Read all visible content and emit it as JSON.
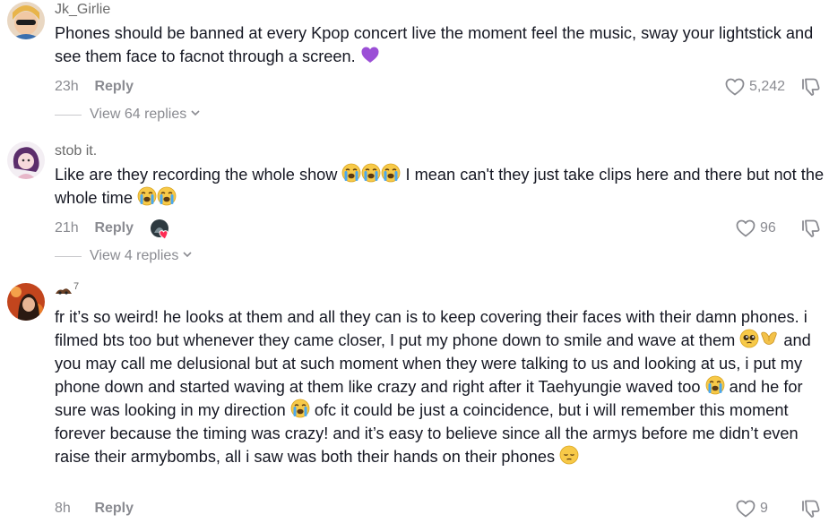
{
  "comments": [
    {
      "username": "Jk_Girlie",
      "text_1": "Phones should be banned at every Kpop concert live the moment feel the music, sway your lightstick and see them face to facnot through a screen. ",
      "time": "23h",
      "reply_label": "Reply",
      "likes": "5,242",
      "view_replies": "View 64 replies",
      "emoji_1": "purple-heart"
    },
    {
      "username": "stob it.",
      "text_1": "Like are they recording the whole show ",
      "text_2": " I mean can't they just take clips here and there but not the whole time ",
      "time": "21h",
      "reply_label": "Reply",
      "likes": "96",
      "view_replies": "View 4 replies",
      "emoji_1": "loudly-crying-face"
    },
    {
      "username": "7",
      "text_1": "fr it’s so weird! he looks at them and all they can is to keep covering their faces with their damn phones. i filmed bts too but whenever they came closer, I put my phone down to smile and wave at them ",
      "text_2": " and you may call me delusional but at such moment when they were talking to us and looking at us, i put my phone down and started waving at them like crazy and right after it Taehyungie waved too ",
      "text_3": " and he for sure was looking in my direction ",
      "text_4": " ofc it could be just a coincidence, but i will remember this moment forever because the timing was crazy! and it’s easy to believe since all the armys before me didn’t even raise their armybombs, all i saw was both their hands on their phones ",
      "time": "8h",
      "reply_label": "Reply",
      "likes": "9",
      "emoji_1": "pleading-face",
      "emoji_2": "heart-hands",
      "emoji_3": "loudly-crying-face",
      "emoji_4": "pensive-face"
    }
  ],
  "colors": {
    "text": "#161823",
    "muted": "#8a8b91",
    "purple_heart": "#9b4fd6",
    "creator_heart": "#fe2c55"
  }
}
